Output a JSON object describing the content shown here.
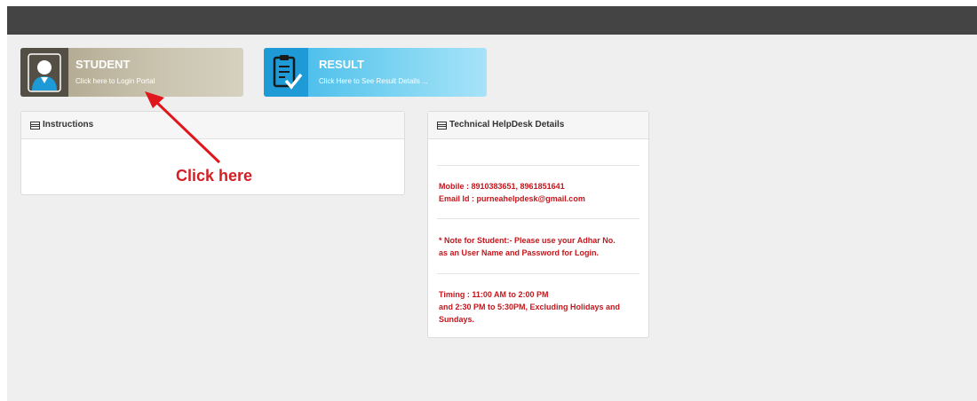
{
  "tiles": {
    "student": {
      "title": "STUDENT",
      "subtitle": "Click here to Login Portal"
    },
    "result": {
      "title": "RESULT",
      "subtitle": "Click Here to See Result Details ..."
    }
  },
  "instructions": {
    "title": "Instructions"
  },
  "helpdesk": {
    "title": "Technical HelpDesk Details",
    "mobile": "Mobile : 8910383651, 8961851641",
    "email": "Email Id : purneahelpdesk@gmail.com",
    "note_line1": "* Note for Student:- Please use your Adhar No.",
    "note_line2": "as an User Name and Password for Login.",
    "timing_line1": "Timing : 11:00 AM to 2:00 PM",
    "timing_line2": "and 2:30 PM to 5:30PM, Excluding Holidays and",
    "timing_line3": "Sundays."
  },
  "annotation": {
    "text": "Click here"
  },
  "colors": {
    "topbar": "#444444",
    "student_tile": "#aa9f86",
    "result_tile": "#39b6e8",
    "helpdesk_text": "#c4161c",
    "annotation": "#d21f25"
  },
  "icons": {
    "student": "user-icon",
    "result": "clipboard-check-icon",
    "panel_header": "list-icon"
  }
}
